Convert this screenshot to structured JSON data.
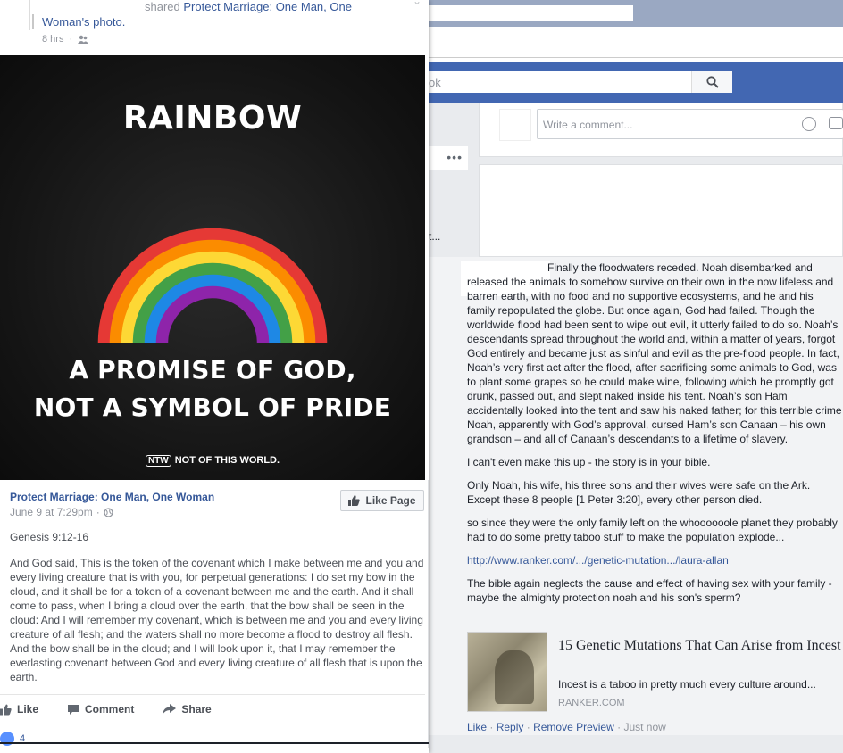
{
  "right": {
    "search_placeholder": "ok",
    "comment_placeholder": "Write a comment...",
    "leftcol_dots": "•••",
    "leftcol_ellipsis": "t...",
    "comment": {
      "paragraphs": [
        "Finally the floodwaters receded. Noah disembarked and released the animals to somehow survive on their own in the now lifeless and barren earth, with no food and no supportive ecosystems, and he and his family repopulated the globe. But once again, God had failed. Though the worldwide flood had been sent to wipe out evil, it utterly failed to do so. Noah’s descendants spread throughout the world and, within a matter of years, forgot God entirely and became just as sinful and evil as the pre-flood people. In fact, Noah’s very first act after the flood, after sacrificing some animals to God, was to plant some grapes so he could make wine, following which he promptly got drunk, passed out, and slept naked inside his tent. Noah’s son Ham accidentally looked into the tent and saw his naked father; for this terrible crime Noah, apparently with God’s approval, cursed Ham’s son Canaan – his own grandson – and all of Canaan’s descendants to a lifetime of slavery.",
        "I can't even make this up - the story is in your bible.",
        "Only Noah, his wife, his three sons and their wives were safe on the Ark. Except these 8 people [1 Peter 3:20], every other person died.",
        "so since they were the only family left on the whoooooole planet they probably had to do some pretty taboo stuff to make the population explode...",
        "The bible again neglects the cause and effect of having sex with your family - maybe the almighty protection noah and his son's sperm?"
      ],
      "link": "http://www.ranker.com/.../genetic-mutation.../laura-allan",
      "preview": {
        "title": "15 Genetic Mutations That Can Arise from Incest",
        "description": "Incest is a taboo in pretty much every culture around...",
        "source": "RANKER.COM"
      },
      "actions": {
        "like": "Like",
        "reply": "Reply",
        "remove_preview": "Remove Preview",
        "time": "Just now",
        "sep": "·"
      }
    }
  },
  "left": {
    "shared_word": "shared",
    "shared_page_part1": "Protect Marriage: One Man, One",
    "shared_page_part2": "Woman",
    "shared_suffix": "'s photo.",
    "time": "8 hrs",
    "meta_sep": "·",
    "image": {
      "title": "RAINBOW",
      "line1": "A PROMISE OF GOD,",
      "line2": "NOT A SYMBOL OF PRIDE",
      "brand_mark": "NTW",
      "brand_text": "NOT OF THIS WORLD."
    },
    "page_name": "Protect Marriage: One Man, One Woman",
    "page_date": "June 9 at 7:29pm",
    "like_page": "Like Page",
    "verse_ref": "Genesis 9:12-16",
    "body": "And God said, This is the token of the covenant which I make between me and you and every living creature that is with you, for perpetual generations: I do set my bow in the cloud, and it shall be for a token of a covenant between me and the earth. And it shall come to pass, when I bring a cloud over the earth, that the bow shall be seen in the cloud: And I will remember my covenant, which is between me and you and every living creature of all flesh; and the waters shall no more become a flood to destroy all flesh. And the bow shall be in the cloud; and I will look upon it, that I may remember the everlasting covenant between God and every living creature of all flesh that is upon the earth.",
    "actions": {
      "like": "Like",
      "comment": "Comment",
      "share": "Share"
    },
    "reaction_count": "4"
  },
  "colors": {
    "fb_blue": "#4267b2",
    "link_blue": "#365899",
    "rainbow": [
      "#e53935",
      "#fb8c00",
      "#fdd835",
      "#43a047",
      "#1e88e5",
      "#8e24aa"
    ]
  }
}
